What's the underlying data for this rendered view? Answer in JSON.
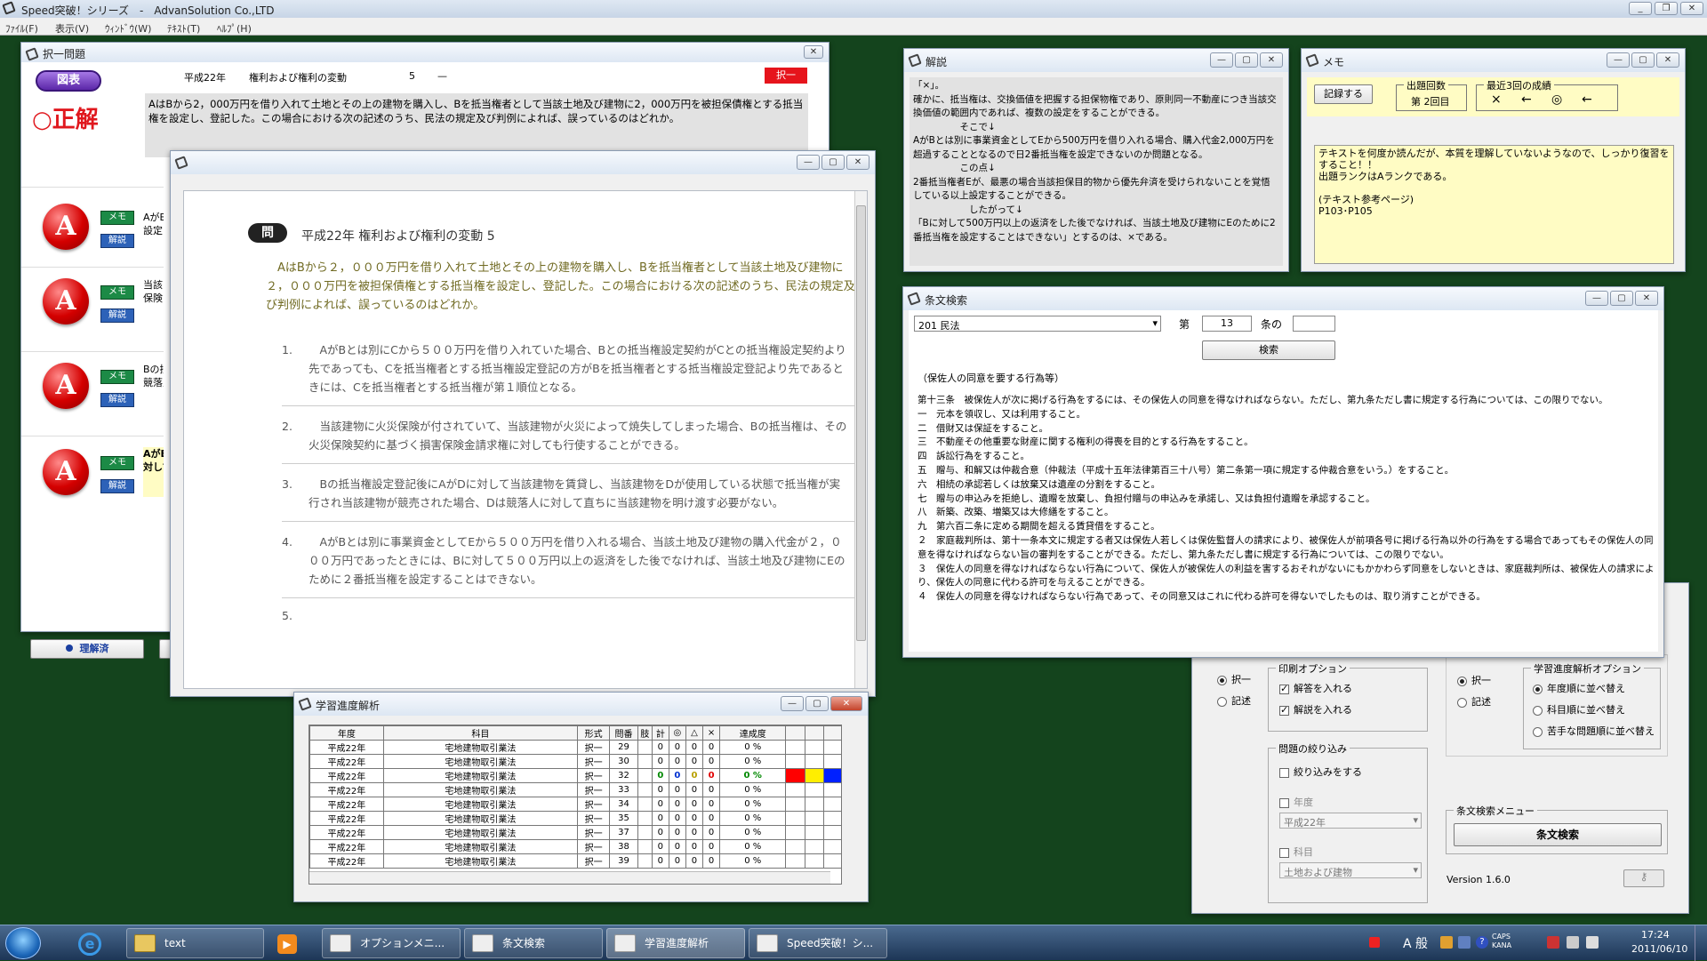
{
  "app": {
    "title": "Speed突破！シリーズ　-　AdvanSolution Co.,LTD",
    "menu": [
      "ﾌｧｲﾙ(F)",
      "表示(V)",
      "ｳｨﾝﾄﾞｳ(W)",
      "ﾃｷｽﾄ(T)",
      "ﾍﾙﾌﾟ(H)"
    ]
  },
  "taku": {
    "title": "択一問題",
    "pill": "図表",
    "seikai": "○正解",
    "year": "平成22年",
    "subject": "権利および権利の変動",
    "num": "5",
    "dash": "—",
    "badge": "択一",
    "question": "AはBから2，000万円を借り入れて土地とその上の建物を購入し、Bを抵当権者として当該土地及び建物に2，000万円を被担保債権とする抵当権を設定し、登記した。この場合における次の記述のうち、民法の規定及び判例によれば、誤っているのはどれか。",
    "choices": [
      {
        "grade": "A",
        "memo": "メモ",
        "kaisetsu": "解説",
        "text": "AがB\n設定"
      },
      {
        "grade": "A",
        "memo": "メモ",
        "kaisetsu": "解説",
        "text": "当該\n保険"
      },
      {
        "grade": "A",
        "memo": "メモ",
        "kaisetsu": "解説",
        "text": "Bの抵\n競落人"
      },
      {
        "grade": "A",
        "memo": "メモ",
        "kaisetsu": "解説",
        "text": "AがE\n対して"
      }
    ],
    "done_btn": "理解済"
  },
  "mondai": {
    "tag": "問",
    "heading": "平成22年 権利および権利の変動 5",
    "intro": "　AはBから２，０００万円を借り入れて土地とその上の建物を購入し、Bを抵当権者として当該土地及び建物に２，０００万円を被担保債権とする抵当権を設定し、登記した。この場合における次の記述のうち、民法の規定及び判例によれば、誤っているのはどれか。",
    "items": [
      {
        "no": "1.",
        "text": "　AがBとは別にCから５００万円を借り入れていた場合、Bとの抵当権設定契約がCとの抵当権設定契約より先であっても、Cを抵当権者とする抵当権設定登記の方がBを抵当権者とする抵当権設定登記より先であるときには、Cを抵当権者とする抵当権が第１順位となる。"
      },
      {
        "no": "2.",
        "text": "　当該建物に火災保険が付されていて、当該建物が火災によって焼失してしまった場合、Bの抵当権は、その火災保険契約に基づく損害保険金請求権に対しても行使することができる。"
      },
      {
        "no": "3.",
        "text": "　Bの抵当権設定登記後にAがDに対して当該建物を賃貸し、当該建物をDが使用している状態で抵当権が実行され当該建物が競売された場合、Dは競落人に対して直ちに当該建物を明け渡す必要がない。"
      },
      {
        "no": "4.",
        "text": "　AがBとは別に事業資金としてEから５００万円を借り入れる場合、当該土地及び建物の購入代金が２，０００万円であったときには、Bに対して５００万円以上の返済をした後でなければ、当該土地及び建物にEのために２番抵当権を設定することはできない。"
      }
    ],
    "cut": "5."
  },
  "kaisetsu": {
    "title": "解説",
    "lines": [
      "「×」。",
      "確かに、抵当権は、交換価値を把握する担保物権であり、原則同一不動産につき当該交換価値の範囲内であれば、複数の設定をすることができる。",
      "　　　　　そこで↓",
      "AがBとは別に事業資金としてEから500万円を借り入れる場合、購入代金2,000万円を超過することとなるので日2番抵当権を設定できないのか問題となる。",
      "　　　　　この点↓",
      "2番抵当権者Eが、最悪の場合当該担保目的物から優先弁済を受けられないことを覚悟している以上設定することができる。",
      "　　　　　　したがって↓",
      "「Bに対して500万円以上の返済をした後でなければ、当該土地及び建物にEのために2番抵当権を設定することはできない」とするのは、×である。"
    ]
  },
  "memo": {
    "title": "メモ",
    "record_btn": "記録する",
    "kaisu_label": "出題回数",
    "kaisu_value": "第 2回目",
    "seiseki_label": "最近3回の成績",
    "marks": [
      "×",
      "←",
      "◎",
      "←"
    ],
    "text": "テキストを何度か読んだが、本質を理解していないようなので、しっかり復習をすること！！\n出題ランクはAランクである。\n\n(テキスト参考ページ)\nP103･P105"
  },
  "jobun": {
    "title": "条文検索",
    "law_select": "201 民法",
    "dai": "第",
    "article": "13",
    "jo_no": "条の",
    "sub_article": "",
    "search_btn": "検索",
    "caption": "（保佐人の同意を要する行為等）",
    "lines": [
      "第十三条　被保佐人が次に掲げる行為をするには、その保佐人の同意を得なければならない。ただし、第九条ただし書に規定する行為については、この限りでない。",
      "一　元本を領収し、又は利用すること。",
      "二　借財又は保証をすること。",
      "三　不動産その他重要な財産に関する権利の得喪を目的とする行為をすること。",
      "四　訴訟行為をすること。",
      "五　贈与、和解又は仲裁合意（仲裁法（平成十五年法律第百三十八号）第二条第一項に規定する仲裁合意をいう。）をすること。",
      "六　相続の承認若しくは放棄又は遺産の分割をすること。",
      "七　贈与の申込みを拒絶し、遺贈を放棄し、負担付贈与の申込みを承諾し、又は負担付遺贈を承認すること。",
      "八　新築、改築、増築又は大修繕をすること。",
      "九　第六百二条に定める期間を超える賃貸借をすること。",
      "２　家庭裁判所は、第十一条本文に規定する者又は保佐人若しくは保佐監督人の請求により、被保佐人が前項各号に掲げる行為以外の行為をする場合であってもその保佐人の同意を得なければならない旨の審判をすることができる。ただし、第九条ただし書に規定する行為については、この限りでない。",
      "３　保佐人の同意を得なければならない行為について、保佐人が被保佐人の利益を害するおそれがないにもかかわらず同意をしないときは、家庭裁判所は、被保佐人の請求により、保佐人の同意に代わる許可を与えることができる。",
      "４　保佐人の同意を得なければならない行為であって、その同意又はこれに代わる許可を得ないでしたものは、取り消すことができる。"
    ]
  },
  "gakushu": {
    "title": "学習進度解析",
    "headers": [
      "年度",
      "科目",
      "形式",
      "問番",
      "肢",
      "計",
      "◎",
      "△",
      "×",
      "達成度",
      "",
      "",
      ""
    ],
    "rows": [
      [
        "平成22年",
        "宅地建物取引業法",
        "択一",
        "29",
        "",
        "0",
        "0",
        "0",
        "0",
        "0 %"
      ],
      [
        "平成22年",
        "宅地建物取引業法",
        "択一",
        "30",
        "",
        "0",
        "0",
        "0",
        "0",
        "0 %"
      ],
      [
        "平成22年",
        "宅地建物取引業法",
        "択一",
        "32",
        "",
        "0",
        "0",
        "0",
        "0",
        "0 %"
      ],
      [
        "平成22年",
        "宅地建物取引業法",
        "択一",
        "33",
        "",
        "0",
        "0",
        "0",
        "0",
        "0 %"
      ],
      [
        "平成22年",
        "宅地建物取引業法",
        "択一",
        "34",
        "",
        "0",
        "0",
        "0",
        "0",
        "0 %"
      ],
      [
        "平成22年",
        "宅地建物取引業法",
        "択一",
        "35",
        "",
        "0",
        "0",
        "0",
        "0",
        "0 %"
      ],
      [
        "平成22年",
        "宅地建物取引業法",
        "択一",
        "37",
        "",
        "0",
        "0",
        "0",
        "0",
        "0 %"
      ],
      [
        "平成22年",
        "宅地建物取引業法",
        "択一",
        "38",
        "",
        "0",
        "0",
        "0",
        "0",
        "0 %"
      ],
      [
        "平成22年",
        "宅地建物取引業法",
        "択一",
        "39",
        "",
        "0",
        "0",
        "0",
        "0",
        "0 %"
      ]
    ],
    "highlight_colors": [
      "#ff0000",
      "#ffee00",
      "#0020ff"
    ]
  },
  "option": {
    "radio1": [
      "択一",
      "記述"
    ],
    "print_group": "印刷オプション",
    "print_opts": [
      "解答を入れる",
      "解説を入れる"
    ],
    "filter_group": "問題の絞り込み",
    "filter_check": "絞り込みをする",
    "year_label": "年度",
    "year_value": "平成22年",
    "subject_label": "科目",
    "subject_value": "土地および建物",
    "radio2": [
      "択一",
      "記述"
    ],
    "analysis_group": "学習進度解析オプション",
    "analysis_opts": [
      "年度順に並べ替え",
      "科目順に並べ替え",
      "苦手な問題順に並べ替え"
    ],
    "jobun_menu": "条文検索メニュー",
    "jobun_btn": "条文検索",
    "version": "Version  1.6.0"
  },
  "taskbar": {
    "items": [
      "text",
      "オプションメニ...",
      "条文検索",
      "学習進度解析",
      "Speed突破！シ..."
    ],
    "ime": "A 般",
    "caps": "CAPS\nKANA",
    "time": "17:24",
    "date": "2011/06/10"
  }
}
